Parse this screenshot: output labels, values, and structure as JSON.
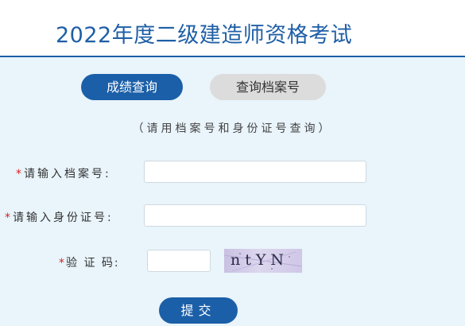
{
  "header": {
    "title": "2022年度二级建造师资格考试"
  },
  "tabs": [
    {
      "label": "成绩查询",
      "active": true
    },
    {
      "label": "查询档案号",
      "active": false
    }
  ],
  "hint": "（请用档案号和身份证号查询）",
  "form": {
    "required_mark": "*",
    "file_number_label": "请输入档案号:",
    "file_number_value": "",
    "id_number_label": "请输入身份证号:",
    "id_number_value": "",
    "captcha_label": "验 证 码:",
    "captcha_value": "",
    "captcha_image_text": "ntYN"
  },
  "submit_label": "提交",
  "colors": {
    "primary": "#1b5fa8",
    "title": "#1f5fa6",
    "panel_bg": "#e9f4fb",
    "required": "#d62020",
    "inactive_tab": "#dcdcdc"
  }
}
